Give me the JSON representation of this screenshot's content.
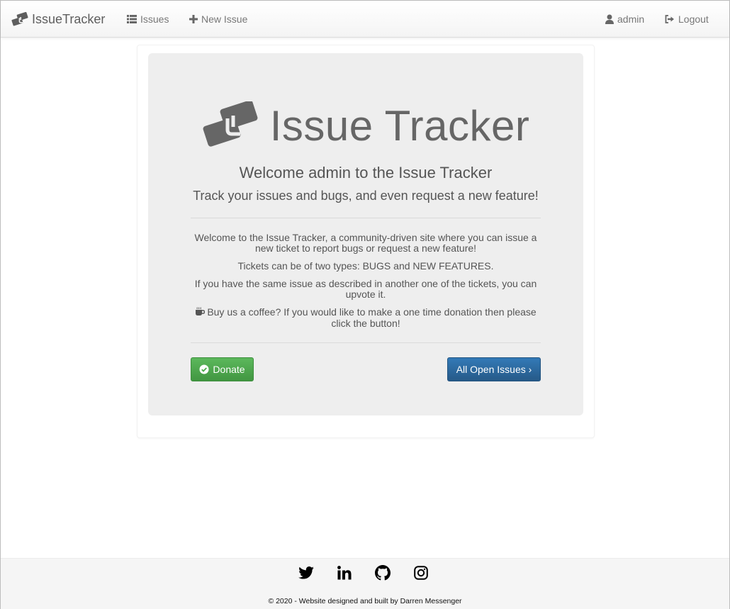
{
  "navbar": {
    "brand": "IssueTracker",
    "issues": "Issues",
    "new_issue": "New Issue",
    "user": "admin",
    "logout": "Logout"
  },
  "hero": {
    "title": "Issue Tracker",
    "welcome": "Welcome admin to the Issue Tracker",
    "tagline": "Track your issues and bugs, and even request a new feature!"
  },
  "body": {
    "p1": "Welcome to the Issue Tracker, a community-driven site where you can issue a new ticket to report bugs or request a new feature!",
    "p2": "Tickets can be of two types: BUGS and NEW FEATURES.",
    "p3": "If you have the same issue as described in another one of the tickets, you can upvote it.",
    "p4": "Buy us a coffee? If you would like to make a one time donation then please click the button!"
  },
  "buttons": {
    "donate": "Donate",
    "all_open_issues": "All Open Issues ›"
  },
  "footer": {
    "social": [
      "twitter-icon",
      "linkedin-icon",
      "github-icon",
      "instagram-icon"
    ],
    "copyright": "© 2020 - Website designed and built by Darren Messenger"
  },
  "colors": {
    "donate": "#5cb85c",
    "primary": "#337ab7",
    "jumbotron": "#eeeeee"
  }
}
